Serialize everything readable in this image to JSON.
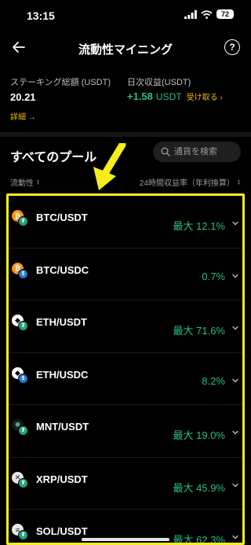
{
  "status_bar": {
    "time": "13:15",
    "battery": "72"
  },
  "nav": {
    "title": "流動性マイニング"
  },
  "summary": {
    "staking_label": "ステーキング総額 (USDT)",
    "staking_value": "20.21",
    "daily_label": "日次収益(USDT)",
    "daily_value": "+1.58",
    "daily_unit": "USDT",
    "claim_label": "受け取る ›",
    "detail_label": "詳細 →"
  },
  "section": {
    "title": "すべてのプール",
    "search_placeholder": "通貨を検索"
  },
  "columns": {
    "left": "流動性",
    "right": "24時間収益率（年利換算）"
  },
  "colors": {
    "accent": "#f0b90b",
    "positive": "#2ebd85",
    "annotation": "#f7ec1c"
  },
  "pools": [
    {
      "name": "BTC/USDT",
      "apr": "最大 12.1%",
      "base": "btc",
      "quote": "usdt"
    },
    {
      "name": "BTC/USDC",
      "apr": "0.7%",
      "base": "btc",
      "quote": "usdc"
    },
    {
      "name": "ETH/USDT",
      "apr": "最大 71.6%",
      "base": "eth",
      "quote": "usdt"
    },
    {
      "name": "ETH/USDC",
      "apr": "8.2%",
      "base": "eth",
      "quote": "usdc"
    },
    {
      "name": "MNT/USDT",
      "apr": "最大 19.0%",
      "base": "mnt",
      "quote": "usdt"
    },
    {
      "name": "XRP/USDT",
      "apr": "最大 45.9%",
      "base": "xrp",
      "quote": "usdt"
    },
    {
      "name": "SOL/USDT",
      "apr": "最大 62.3%",
      "base": "sol",
      "quote": "usdt"
    }
  ]
}
